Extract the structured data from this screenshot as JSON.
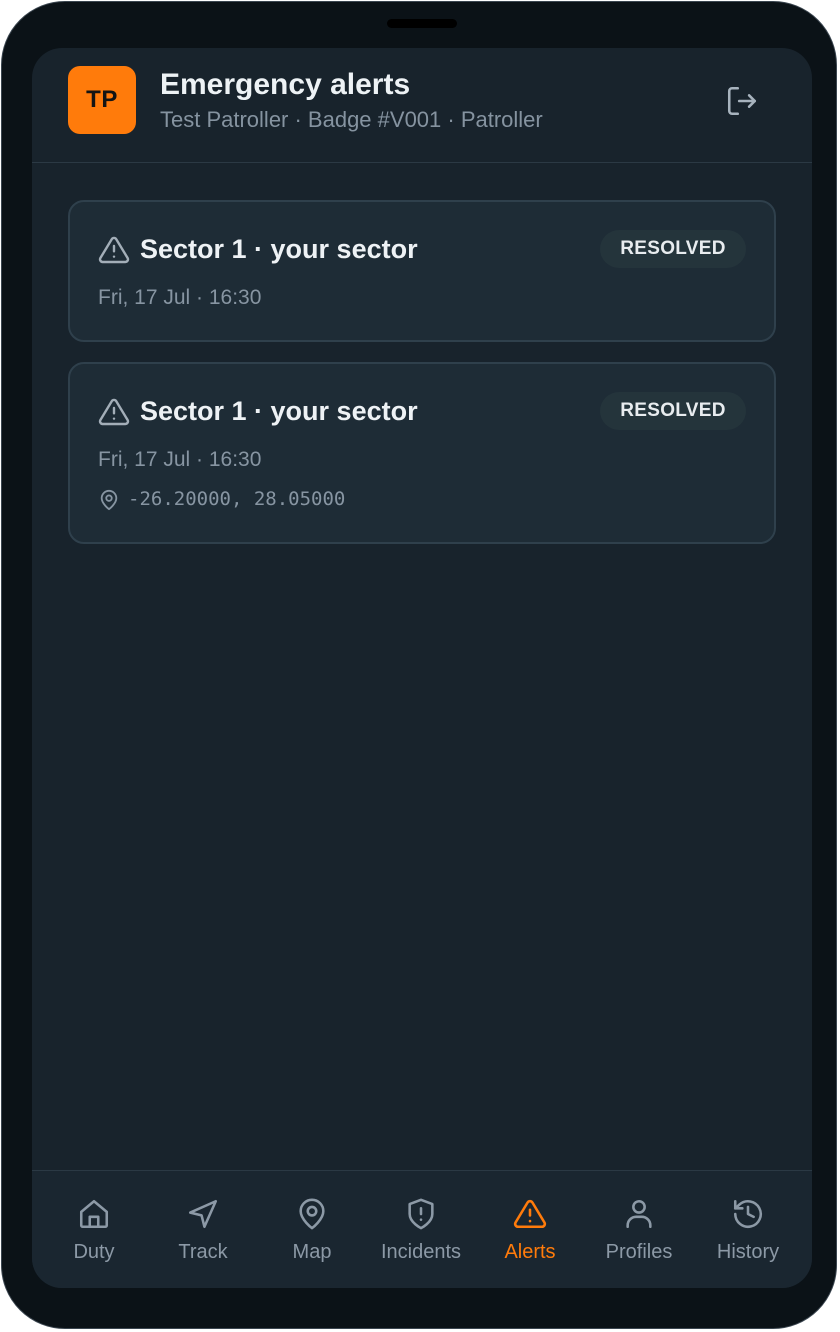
{
  "colors": {
    "accent": "#ff7b0b",
    "background": "#18232c",
    "card": "#1e2c36",
    "muted_text": "#8795a2"
  },
  "header": {
    "avatar_initials": "TP",
    "title": "Emergency alerts",
    "subtitle": "Test Patroller · Badge #V001 · Patroller",
    "logout_icon": "logout-icon"
  },
  "alerts": [
    {
      "icon": "warning-triangle-icon",
      "title": "Sector 1 · your sector",
      "status": "RESOLVED",
      "time": "Fri, 17 Jul · 16:30"
    },
    {
      "icon": "warning-triangle-icon",
      "title": "Sector 1 · your sector",
      "status": "RESOLVED",
      "time": "Fri, 17 Jul · 16:30",
      "location_icon": "map-pin-icon",
      "coordinates": "-26.20000, 28.05000"
    }
  ],
  "nav": {
    "active": "Alerts",
    "items": [
      {
        "label": "Duty",
        "icon": "home-icon"
      },
      {
        "label": "Track",
        "icon": "navigation-arrow-icon"
      },
      {
        "label": "Map",
        "icon": "map-pin-icon"
      },
      {
        "label": "Incidents",
        "icon": "shield-alert-icon"
      },
      {
        "label": "Alerts",
        "icon": "warning-triangle-icon"
      },
      {
        "label": "Profiles",
        "icon": "user-icon"
      },
      {
        "label": "History",
        "icon": "history-icon"
      }
    ]
  }
}
